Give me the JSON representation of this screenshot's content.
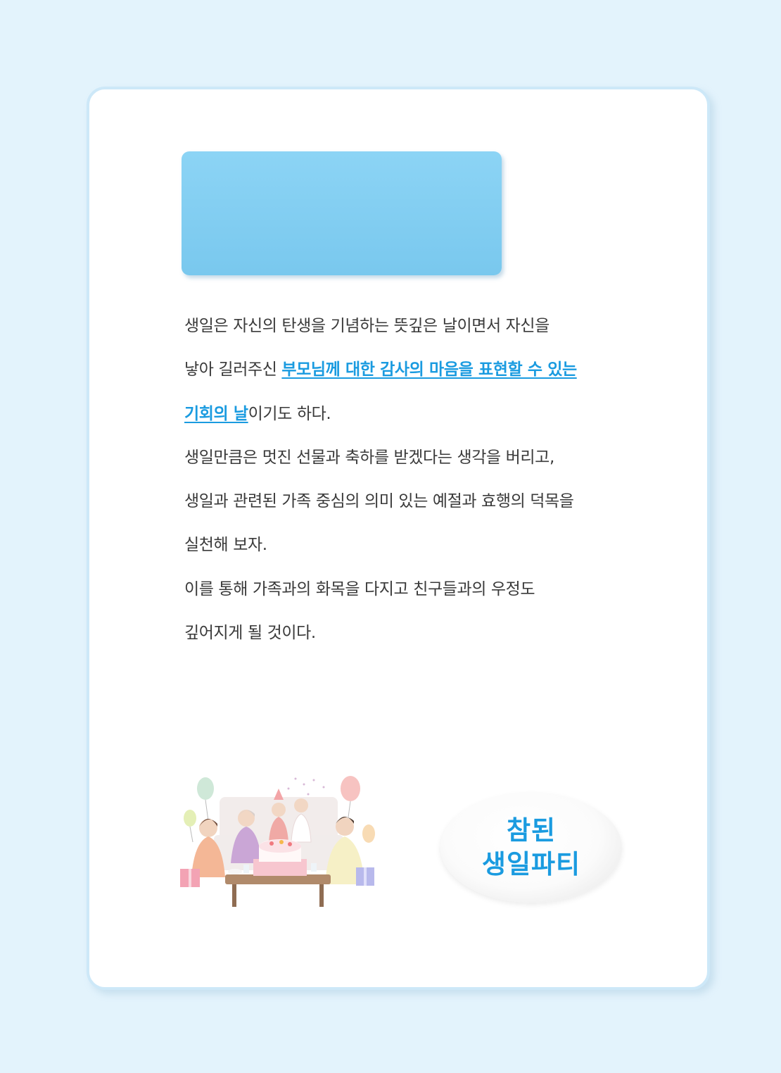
{
  "body": {
    "paragraph1": {
      "line1": "생일은 자신의 탄생을 기념하는 뜻깊은 날이면서 자신을",
      "line2_prefix": "낳아 길러주신 ",
      "line2_highlight": "부모님께 대한 감사의 마음을 표현할 수 있는 ",
      "line3_highlight": "기회의 날",
      "line3_suffix": "이기도 하다."
    },
    "paragraph2": {
      "line1": "생일만큼은 멋진 선물과 축하를 받겠다는 생각을 버리고,",
      "line2": "생일과 관련된 가족 중심의 의미 있는 예절과 효행의 덕목을",
      "line3": "실천해 보자."
    },
    "paragraph3": {
      "line1": "이를 통해 가족과의 화목을 다지고 친구들과의 우정도",
      "line2": "깊어지게 될 것이다."
    }
  },
  "badge": {
    "line1": "참된",
    "line2": "생일파티"
  },
  "colors": {
    "accent": "#1a9be0",
    "header_box": "#80ccf0",
    "page_background": "#e3f3fc"
  }
}
